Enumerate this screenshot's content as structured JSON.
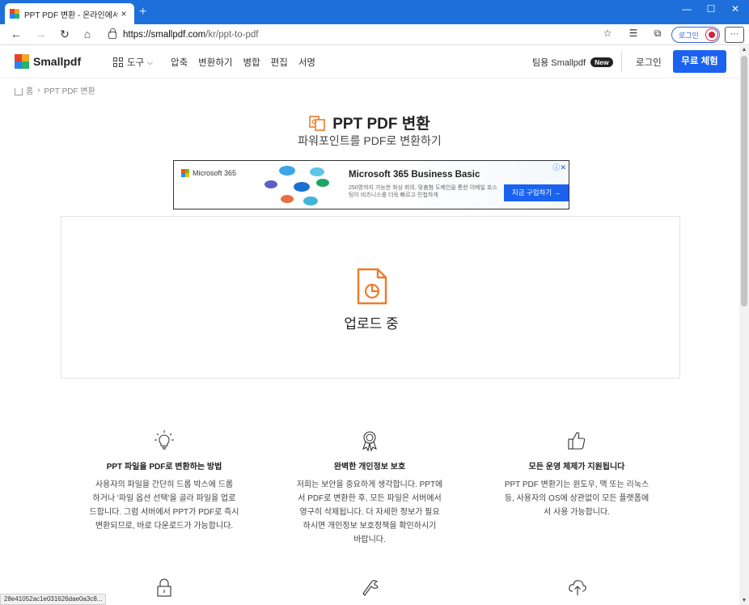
{
  "browser": {
    "tab_title": "PPT PDF 변환 - 온라인에서 파워",
    "tab_close": "×",
    "new_tab": "+",
    "window_controls": {
      "minimize": "—",
      "maximize": "☐",
      "close": "✕"
    },
    "nav": {
      "back": "←",
      "forward": "→",
      "reload": "↻",
      "home": "⌂"
    },
    "url_host": "https://smallpdf.com",
    "url_path": "/kr/ppt-to-pdf",
    "login_pill": "로그인",
    "more": "···",
    "status_url": "28e41052ac1e031626dae0a3c8..."
  },
  "header": {
    "logo_text": "Smallpdf",
    "tools_label": "도구",
    "menu_items": [
      "압축",
      "변환하기",
      "병합",
      "편집",
      "서명"
    ],
    "team_label": "팀용 Smallpdf",
    "new_badge": "New",
    "login": "로그인",
    "trial": "무료 체험"
  },
  "breadcrumb": {
    "home": "홈",
    "sep": "›",
    "current": "PPT PDF 변환"
  },
  "hero": {
    "title": "PPT PDF 변환",
    "subtitle": "파워포인트를 PDF로 변환하기"
  },
  "ad": {
    "brand": "Microsoft 365",
    "headline": "Microsoft 365 Business Basic",
    "desc": "250명까지 가능한 화상 회의, 맞춤형 도메인을 통한 이메일 호스팅이 비즈니스를 더욱 빠르고 민첩하게",
    "cta": "지금 구입하기 →",
    "adchoice": "ⓘ✕"
  },
  "upload": {
    "status": "업로드 중"
  },
  "features": [
    {
      "icon": "lightbulb-icon",
      "title": "PPT 파일을 PDF로 변환하는 방법",
      "lines": [
        "사용자의 파일을 간단히 드롭 박스에 드롭",
        "하거나 '파일 옵션 선택'을 골라 파일을 업로",
        "드합니다. 그럼 서버에서 PPT가 PDF로 즉시",
        "변환되므로, 바로 다운로드가 가능합니다."
      ]
    },
    {
      "icon": "award-icon",
      "title": "완벽한 개인정보 보호",
      "lines": [
        "저희는 보안을 중요하게 생각합니다. PPT에",
        "서 PDF로 변환한 후, 모든 파일은 서버에서",
        "영구히 삭제됩니다. 더 자세한 정보가 필요",
        "하시면 개인정보 보호정책을 확인하시기",
        "바랍니다."
      ]
    },
    {
      "icon": "thumbs-up-icon",
      "title": "모든 운영 체제가 지원됩니다",
      "lines": [
        "PPT PDF 변환기는 윈도우, 맥 또는 리눅스",
        "등, 사용자의 OS에 상관없이 모든 플랫폼에",
        "서 사용 가능합니다."
      ]
    }
  ],
  "colors": {
    "accent_blue": "#1a62ef",
    "chrome_blue": "#1e6fd9",
    "ppt_orange": "#f07a2a"
  }
}
